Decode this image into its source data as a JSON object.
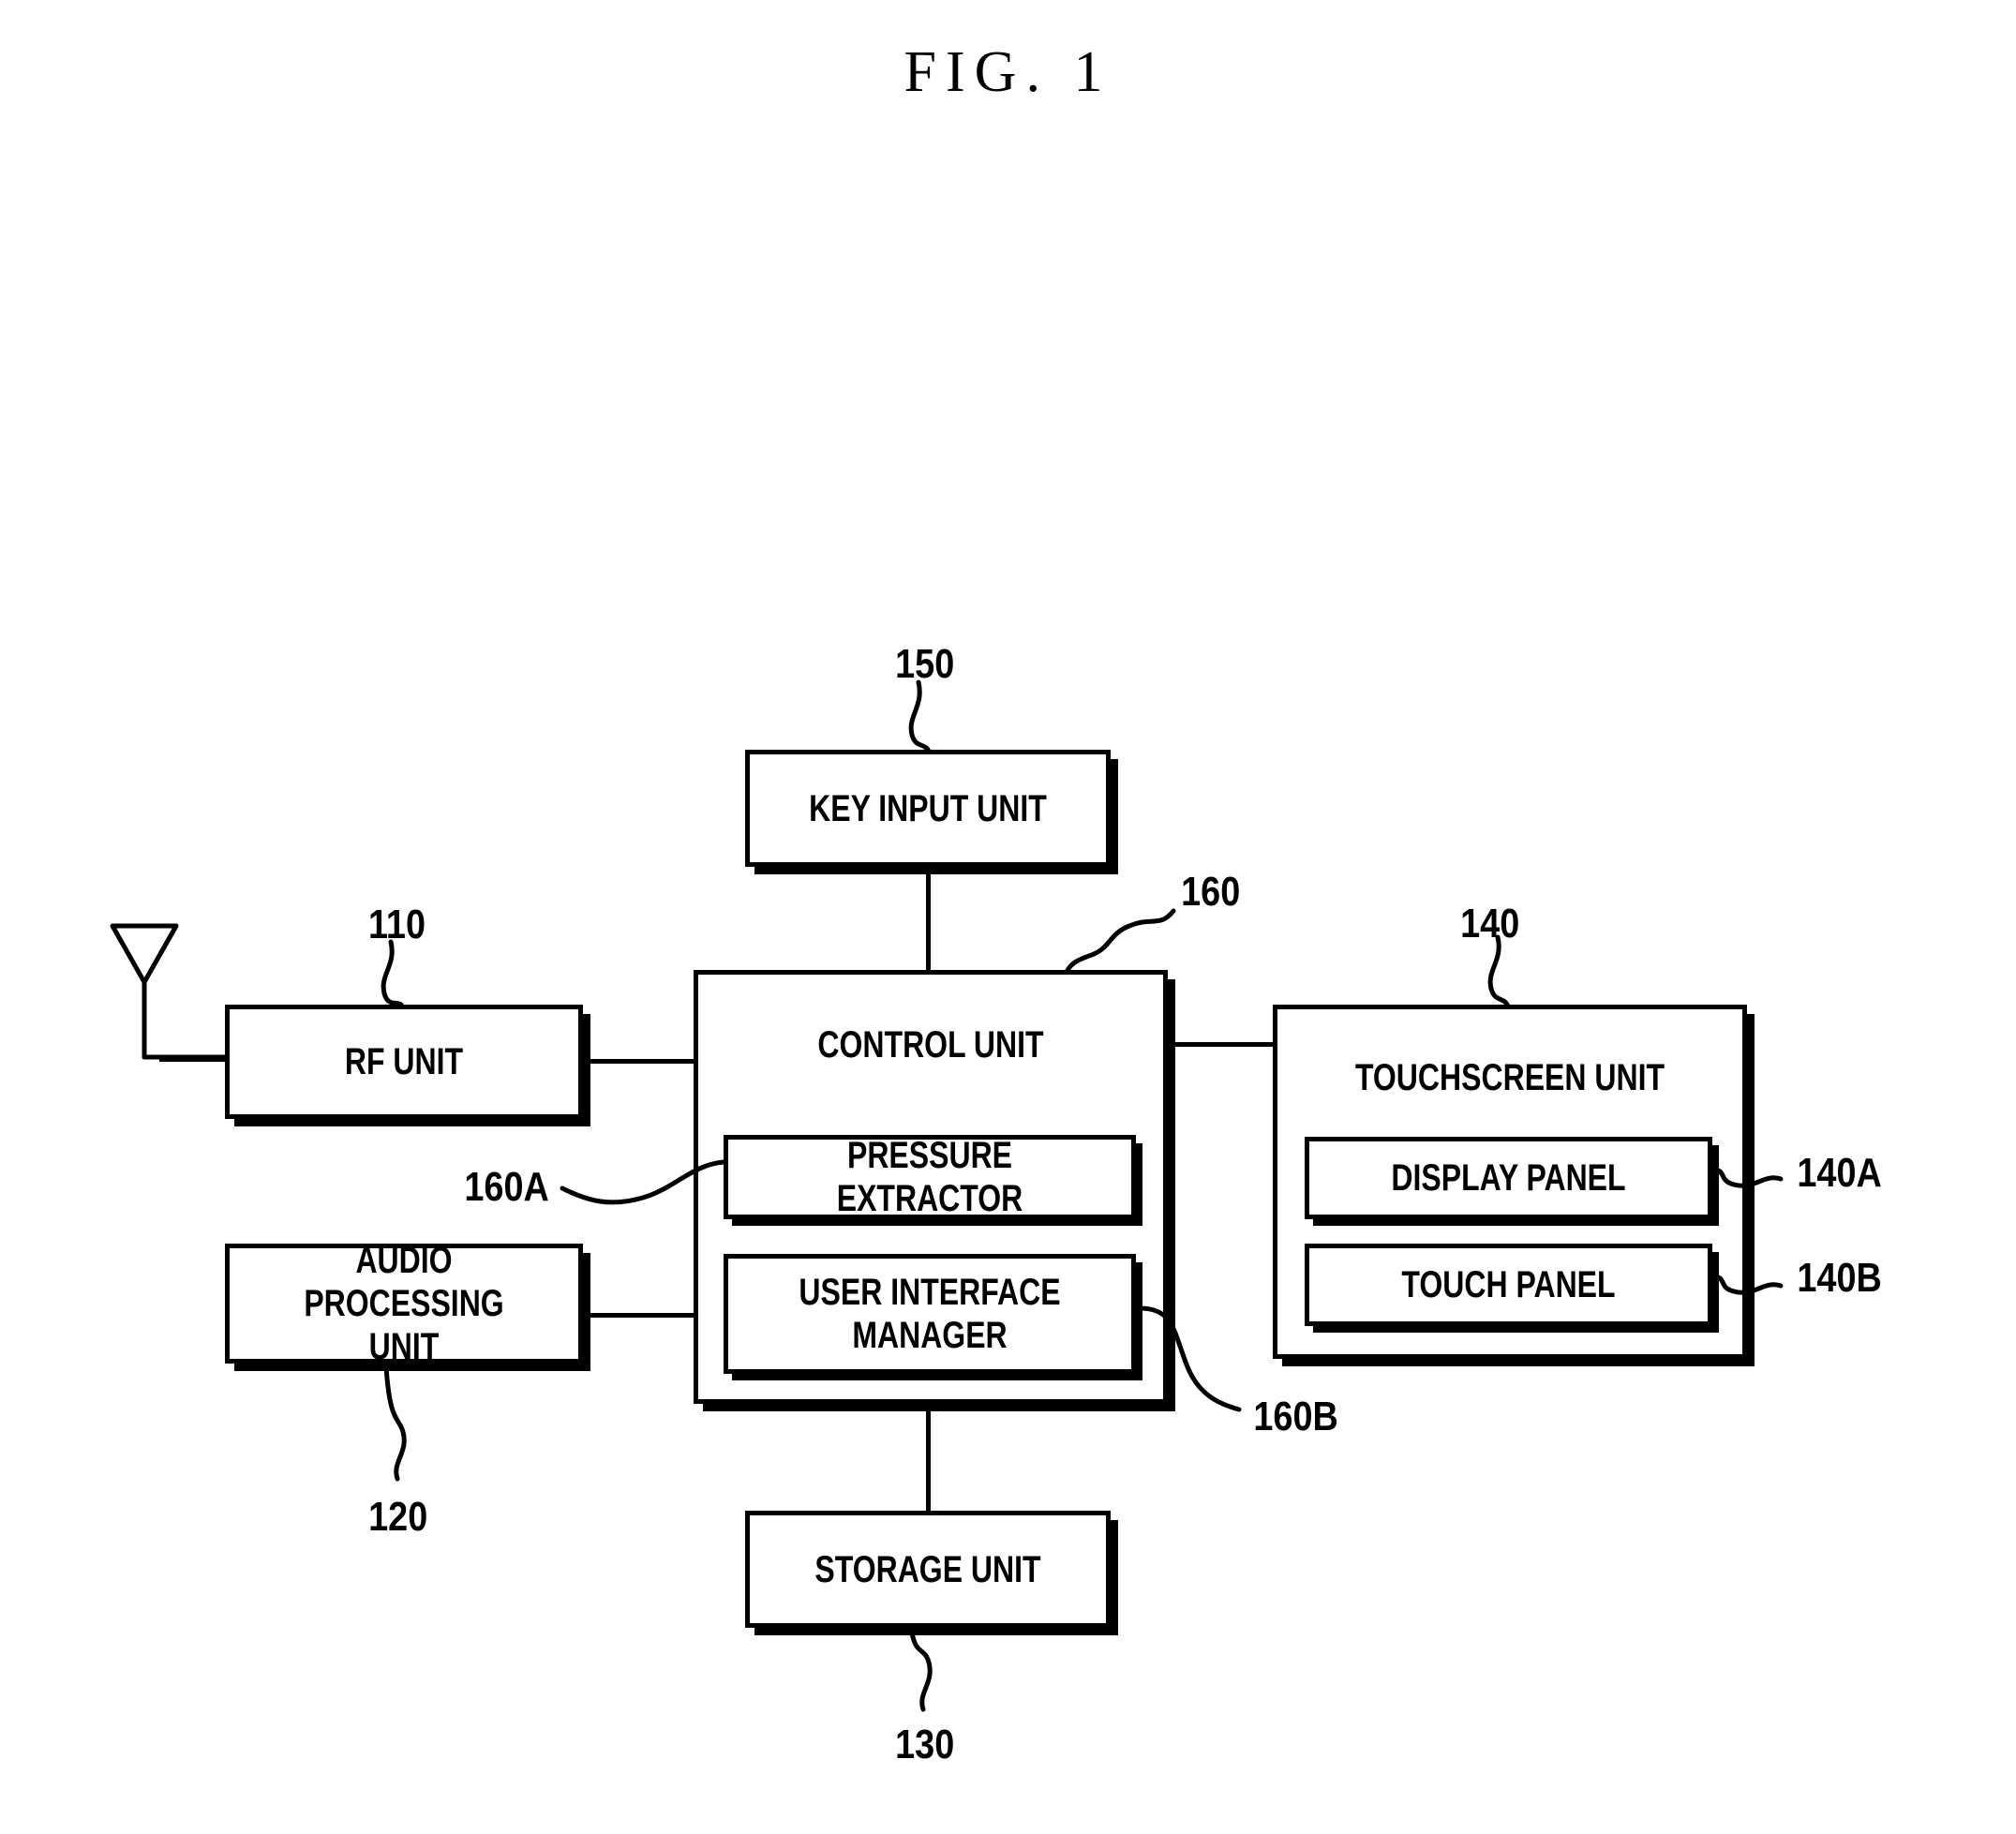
{
  "figure": {
    "title": "FIG. 1",
    "type": "block-diagram",
    "subject": "Mobile terminal block diagram with pressure-sensitive touchscreen"
  },
  "blocks": {
    "rf_unit": {
      "label": "RF UNIT",
      "ref": "110"
    },
    "audio_processing_unit": {
      "label": "AUDIO PROCESSING\nUNIT",
      "ref": "120"
    },
    "storage_unit": {
      "label": "STORAGE UNIT",
      "ref": "130"
    },
    "touchscreen_unit": {
      "label": "TOUCHSCREEN UNIT",
      "ref": "140"
    },
    "display_panel": {
      "label": "DISPLAY PANEL",
      "ref": "140A"
    },
    "touch_panel": {
      "label": "TOUCH PANEL",
      "ref": "140B"
    },
    "key_input_unit": {
      "label": "KEY INPUT UNIT",
      "ref": "150"
    },
    "control_unit": {
      "label": "CONTROL UNIT",
      "ref": "160"
    },
    "pressure_extractor": {
      "label": "PRESSURE EXTRACTOR",
      "ref": "160A"
    },
    "user_interface_manager": {
      "label": "USER INTERFACE\nMANAGER",
      "ref": "160B"
    }
  },
  "icons": {
    "antenna": "antenna-icon"
  },
  "colors": {
    "line": "#000000",
    "background": "#ffffff"
  }
}
